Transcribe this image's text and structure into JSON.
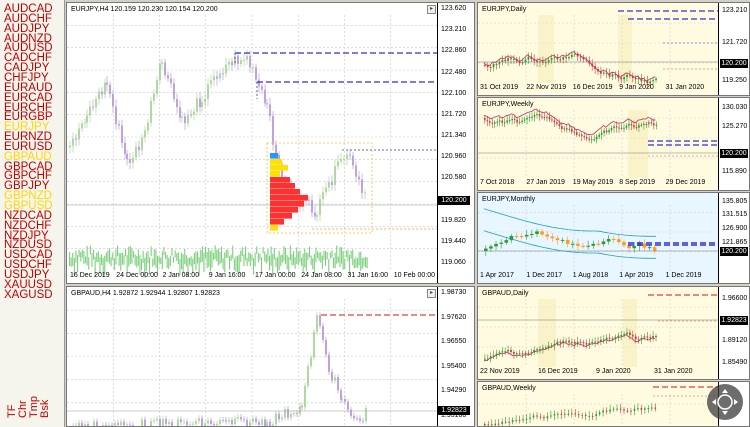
{
  "sidebar": {
    "symbols": [
      {
        "label": "AUDCAD",
        "hl": false
      },
      {
        "label": "AUDCHF",
        "hl": false
      },
      {
        "label": "AUDJPY",
        "hl": false
      },
      {
        "label": "AUDNZD",
        "hl": false
      },
      {
        "label": "AUDUSD",
        "hl": false
      },
      {
        "label": "CADCHF",
        "hl": false
      },
      {
        "label": "CADJPY",
        "hl": false
      },
      {
        "label": "CHFJPY",
        "hl": false
      },
      {
        "label": "EURAUD",
        "hl": false
      },
      {
        "label": "EURCAD",
        "hl": false
      },
      {
        "label": "EURCHF",
        "hl": false
      },
      {
        "label": "EURGBP",
        "hl": false
      },
      {
        "label": "EURJPY",
        "hl": true
      },
      {
        "label": "EURNZD",
        "hl": false
      },
      {
        "label": "EURUSD",
        "hl": false
      },
      {
        "label": "GBPAUD",
        "hl": true
      },
      {
        "label": "GBPCAD",
        "hl": false
      },
      {
        "label": "GBPCHF",
        "hl": false
      },
      {
        "label": "GBPJPY",
        "hl": false
      },
      {
        "label": "GBPNZD",
        "hl": true
      },
      {
        "label": "GBPUSD",
        "hl": true
      },
      {
        "label": "NZDCAD",
        "hl": false
      },
      {
        "label": "NZDCHF",
        "hl": false
      },
      {
        "label": "NZDJPY",
        "hl": false
      },
      {
        "label": "NZDUSD",
        "hl": false
      },
      {
        "label": "USDCAD",
        "hl": false
      },
      {
        "label": "USDCHF",
        "hl": false
      },
      {
        "label": "USDJPY",
        "hl": false
      },
      {
        "label": "XAUUSD",
        "hl": false
      },
      {
        "label": "XAGUSD",
        "hl": false
      }
    ],
    "vertical": [
      "TF",
      "Chr",
      "Tmp",
      "Bsk"
    ]
  },
  "charts": {
    "main_top": {
      "title": "EURJPY,H4  120.159 120.230 120.154 120.200",
      "y_labels": [
        "123.620",
        "123.210",
        "122.860",
        "122.480",
        "122.100",
        "121.720",
        "121.340",
        "120.960",
        "120.580",
        "120.200",
        "119.820",
        "119.440",
        "119.060"
      ],
      "x_labels": [
        "16 Dec 2019",
        "24 Dec 00:00",
        "2 Jan 08:00",
        "9 Jan 16:00",
        "17 Jan 00:00",
        "24 Jan 08:00",
        "31 Jan 16:00",
        "10 Feb 00:00"
      ],
      "price": "120.200"
    },
    "main_bottom": {
      "title": "GBPAUD,H4  1.92872 1.92944 1.92807 1.92823",
      "y_labels": [
        "1.98730",
        "1.97620",
        "1.96550",
        "1.95400",
        "1.94290",
        "1.93180"
      ],
      "price": "1.92823"
    },
    "eurjpy_daily": {
      "title": "EURJPY,Daily",
      "y_labels": [
        "123.210",
        "121.720",
        "120.200",
        "119.250"
      ],
      "x_labels": [
        "31 Oct 2019",
        "22 Nov 2019",
        "16 Dec 2019",
        "9 Jan 2020",
        "31 Jan 2020"
      ],
      "price": "120.200"
    },
    "eurjpy_weekly": {
      "title": "EURJPY,Weekly",
      "y_labels": [
        "130.030",
        "125.270",
        "120.200",
        "115.890"
      ],
      "x_labels": [
        "7 Oct 2018",
        "27 Jan 2019",
        "19 May 2019",
        "8 Sep 2019",
        "29 Dec 2019"
      ],
      "price": "120.200"
    },
    "eurjpy_monthly": {
      "title": "EURJPY,Monthly",
      "y_labels": [
        "135.805",
        "131.515",
        "126.900",
        "121.865",
        "120.200"
      ],
      "x_labels": [
        "1 Apr 2017",
        "1 Dec 2017",
        "1 Aug 2018",
        "1 Apr 2019",
        "1 Dec 2019"
      ],
      "price": "120.200"
    },
    "gbpaud_daily": {
      "title": "GBPAUD,Daily",
      "y_labels": [
        "1.96600",
        "1.92823",
        "1.89120",
        "1.85490"
      ],
      "x_labels": [
        "22 Nov 2019",
        "16 Dec 2019",
        "9 Jan 2020",
        "31 Jan 2020"
      ],
      "price": "1.92823"
    },
    "gbpaud_weekly": {
      "title": "GBPAUD,Weekly"
    }
  },
  "colors": {
    "symbol": "#c00000",
    "highlight": "#ffd800",
    "bull": "#2d9a2d",
    "bear": "#9a60c8",
    "level": "#3030d0",
    "alert": "#e04040"
  }
}
